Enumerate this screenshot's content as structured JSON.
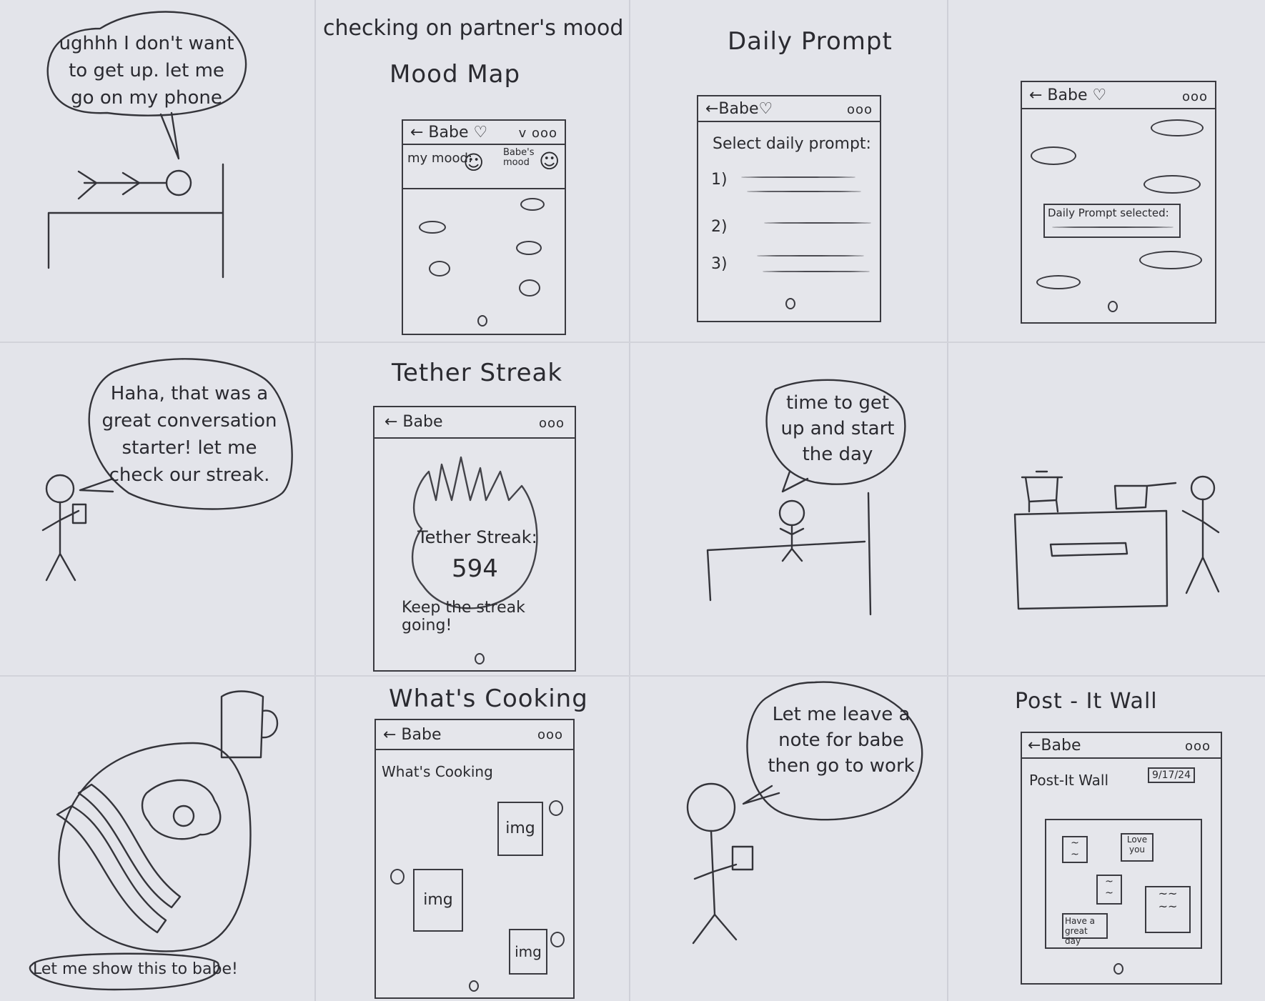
{
  "panels": {
    "p1": {
      "bubble": "ughhh I don't want to get up. let me go on my phone"
    },
    "p2": {
      "caption": "checking on partner's mood",
      "title": "Mood Map",
      "header_name": "← Babe ♡",
      "header_icons": "v ooo",
      "my_mood_label": "my mood:",
      "babe_mood_label": "Babe's mood"
    },
    "p3": {
      "title": "Daily Prompt",
      "header_name": "←Babe♡",
      "header_icons": "ooo",
      "instruction": "Select daily prompt:",
      "items": [
        "1)",
        "2)",
        "3)"
      ]
    },
    "p4": {
      "header_name": "← Babe ♡",
      "header_icons": "ooo",
      "selected_label": "Daily Prompt selected:"
    },
    "p5": {
      "bubble": "Haha, that was a great conversation starter! let me check our streak."
    },
    "p6": {
      "title": "Tether Streak",
      "header_name": "← Babe",
      "header_icons": "ooo",
      "streak_label": "Tether Streak:",
      "streak_value": "594",
      "message": "Keep the streak going!"
    },
    "p7": {
      "bubble": "time to get up and start the day"
    },
    "p9": {
      "bubble": "Let me show this to babe!"
    },
    "p10": {
      "title": "What's Cooking",
      "header_name": "← Babe",
      "header_icons": "ooo",
      "heading": "What's Cooking",
      "img_labels": [
        "img",
        "img",
        "img"
      ]
    },
    "p11": {
      "bubble": "Let me leave a note for babe then go to work"
    },
    "p12": {
      "title": "Post - It Wall",
      "header_name": "←Babe",
      "header_icons": "ooo",
      "heading": "Post-It Wall",
      "date": "9/17/24",
      "notes": [
        "Love you",
        "Have a great day"
      ]
    }
  }
}
